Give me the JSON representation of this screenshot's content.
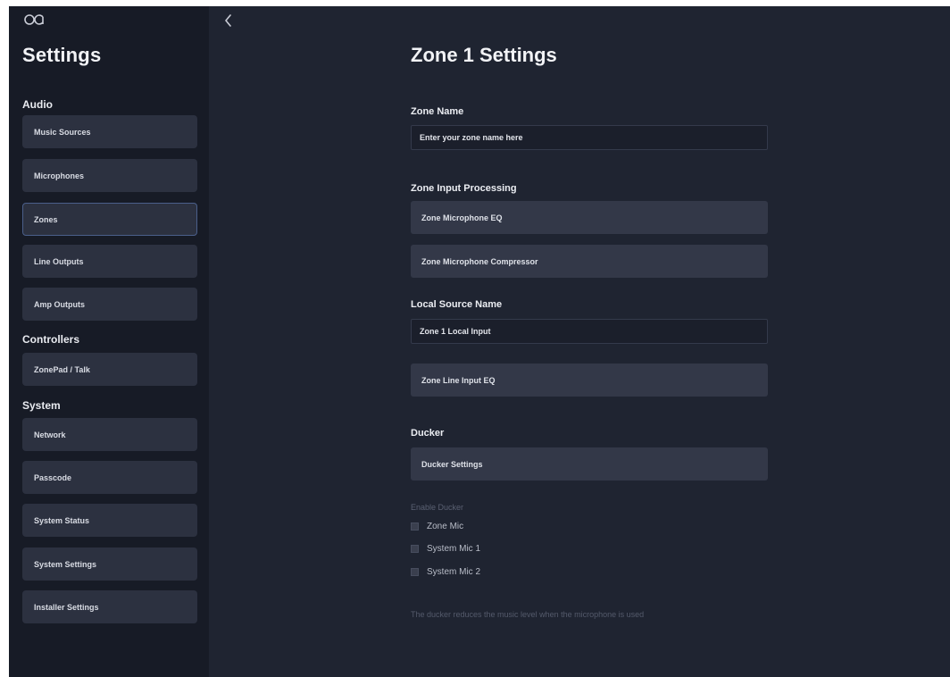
{
  "sidebar": {
    "title": "Settings",
    "groups": [
      {
        "label": "Audio",
        "items": [
          "Music Sources",
          "Microphones",
          "Zones",
          "Line Outputs",
          "Amp Outputs"
        ]
      },
      {
        "label": "Controllers",
        "items": [
          "ZonePad / Talk"
        ]
      },
      {
        "label": "System",
        "items": [
          "Network",
          "Passcode",
          "System Status",
          "System Settings",
          "Installer Settings"
        ]
      }
    ],
    "active_item": "Zones"
  },
  "main": {
    "title": "Zone 1 Settings",
    "zone_name": {
      "label": "Zone Name",
      "value": "",
      "placeholder": "Enter your zone name here"
    },
    "input_processing": {
      "label": "Zone Input Processing",
      "eq": "Zone Microphone EQ",
      "compressor": "Zone Microphone Compressor"
    },
    "local_source": {
      "label": "Local Source Name",
      "value": "Zone 1 Local Input",
      "line_eq": "Zone Line Input EQ"
    },
    "ducker": {
      "label": "Ducker",
      "settings": "Ducker Settings",
      "enable_label": "Enable Ducker",
      "options": [
        {
          "label": "Zone Mic",
          "checked": false
        },
        {
          "label": "System Mic 1",
          "checked": false
        },
        {
          "label": "System Mic 2",
          "checked": false
        }
      ],
      "note": "The ducker reduces the music level when the microphone is used"
    }
  },
  "icons": {
    "logo": "brand-logo-icon",
    "back": "chevron-left-icon"
  },
  "colors": {
    "background": "#1f2431",
    "sidebar": "#171b26",
    "item": "#2c3140",
    "active_border": "#4a5f8a"
  }
}
